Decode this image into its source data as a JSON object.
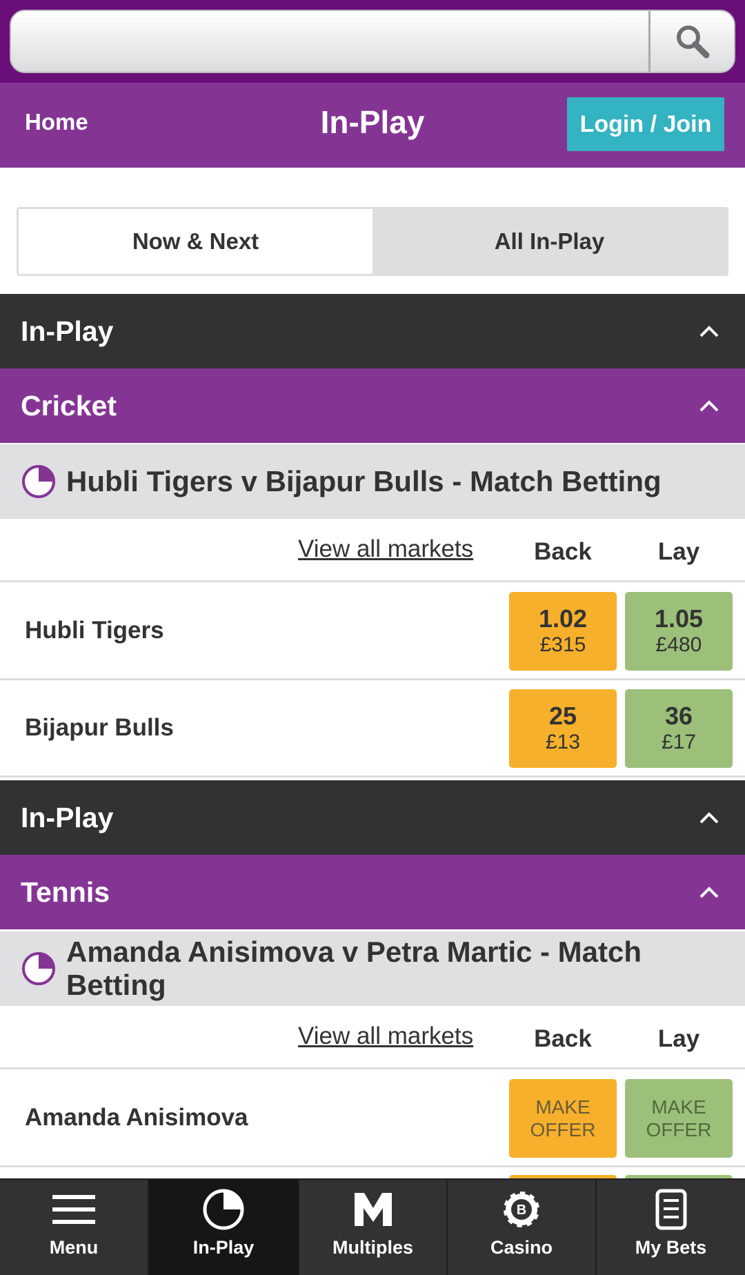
{
  "search": {
    "placeholder": "",
    "icon": "search-icon"
  },
  "topnav": {
    "home": "Home",
    "title": "In-Play",
    "login": "Login / Join"
  },
  "toggle": {
    "tabs": [
      "Now & Next",
      "All In-Play"
    ],
    "active": "Now & Next"
  },
  "sections": [
    {
      "header": "In-Play",
      "sport": "Cricket",
      "event": "Hubli Tigers v Bijapur Bulls - Match Betting",
      "view_all": "View all markets",
      "back_label": "Back",
      "lay_label": "Lay",
      "runners": [
        {
          "name": "Hubli Tigers",
          "back_price": "1.02",
          "back_stake": "£315",
          "lay_price": "1.05",
          "lay_stake": "£480"
        },
        {
          "name": "Bijapur Bulls",
          "back_price": "25",
          "back_stake": "£13",
          "lay_price": "36",
          "lay_stake": "£17"
        }
      ]
    },
    {
      "header": "In-Play",
      "sport": "Tennis",
      "event": "Amanda Anisimova v Petra Martic - Match Betting",
      "view_all": "View all markets",
      "back_label": "Back",
      "lay_label": "Lay",
      "runners": [
        {
          "name": "Amanda Anisimova",
          "back_offer_1": "MAKE",
          "back_offer_2": "OFFER",
          "lay_offer_1": "MAKE",
          "lay_offer_2": "OFFER"
        }
      ]
    }
  ],
  "bottomnav": [
    {
      "label": "Menu",
      "icon": "hamburger-menu-icon"
    },
    {
      "label": "In-Play",
      "icon": "clock-pie-icon",
      "active": true
    },
    {
      "label": "Multiples",
      "icon": "m-letter-icon"
    },
    {
      "label": "Casino",
      "icon": "casino-chip-icon"
    },
    {
      "label": "My Bets",
      "icon": "bet-slip-icon"
    }
  ],
  "colors": {
    "brand_purple": "#843594",
    "dark_bar": "#323133",
    "back_orange": "#f7b02b",
    "lay_green": "#9cc07a",
    "login_teal": "#34b3c2"
  }
}
